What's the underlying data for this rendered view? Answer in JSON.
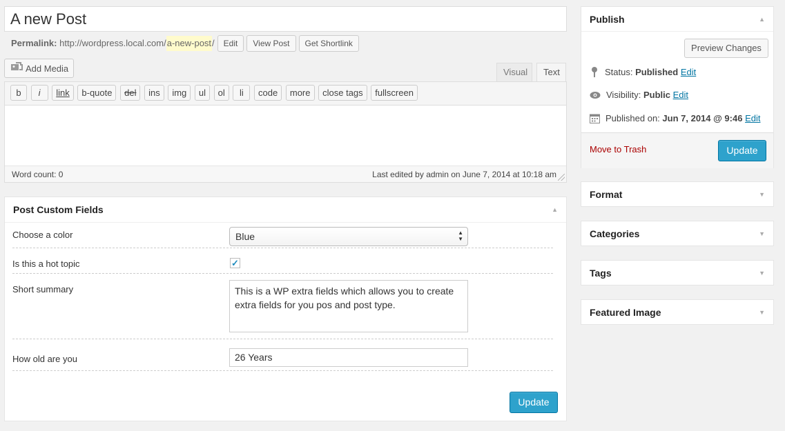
{
  "post": {
    "title": "A new Post",
    "permalink_label": "Permalink:",
    "permalink_base": "http://wordpress.local.com/",
    "permalink_slug": "a-new-post",
    "permalink_tail": "/",
    "edit_btn": "Edit",
    "view_btn": "View Post",
    "shortlink_btn": "Get Shortlink"
  },
  "editor": {
    "add_media": "Add Media",
    "tab_visual": "Visual",
    "tab_text": "Text",
    "quicktags": [
      "b",
      "i",
      "link",
      "b-quote",
      "del",
      "ins",
      "img",
      "ul",
      "ol",
      "li",
      "code",
      "more",
      "close tags",
      "fullscreen"
    ],
    "word_count": "Word count: 0",
    "last_edited": "Last edited by admin on June 7, 2014 at 10:18 am"
  },
  "custom_fields": {
    "title": "Post Custom Fields",
    "color_label": "Choose a color",
    "color_value": "Blue",
    "hot_label": "Is this a hot topic",
    "hot_checked": true,
    "summary_label": "Short summary",
    "summary_value": "This is a WP extra fields which allows you to create extra fields for you pos and post type.",
    "age_label": "How old are you",
    "age_value": "26 Years",
    "update_btn": "Update"
  },
  "publish": {
    "title": "Publish",
    "preview_btn": "Preview Changes",
    "status_label": "Status:",
    "status_value": "Published",
    "visibility_label": "Visibility:",
    "visibility_value": "Public",
    "published_label": "Published on:",
    "published_value": "Jun 7, 2014 @ 9:46",
    "edit_link": "Edit",
    "trash_link": "Move to Trash",
    "update_btn": "Update"
  },
  "sidebar_boxes": {
    "format": "Format",
    "categories": "Categories",
    "tags": "Tags",
    "featured_image": "Featured Image"
  },
  "colors": {
    "primary": "#2ea2cc",
    "link": "#0074a2",
    "trash": "#aa0000",
    "background": "#f1f1f1"
  }
}
